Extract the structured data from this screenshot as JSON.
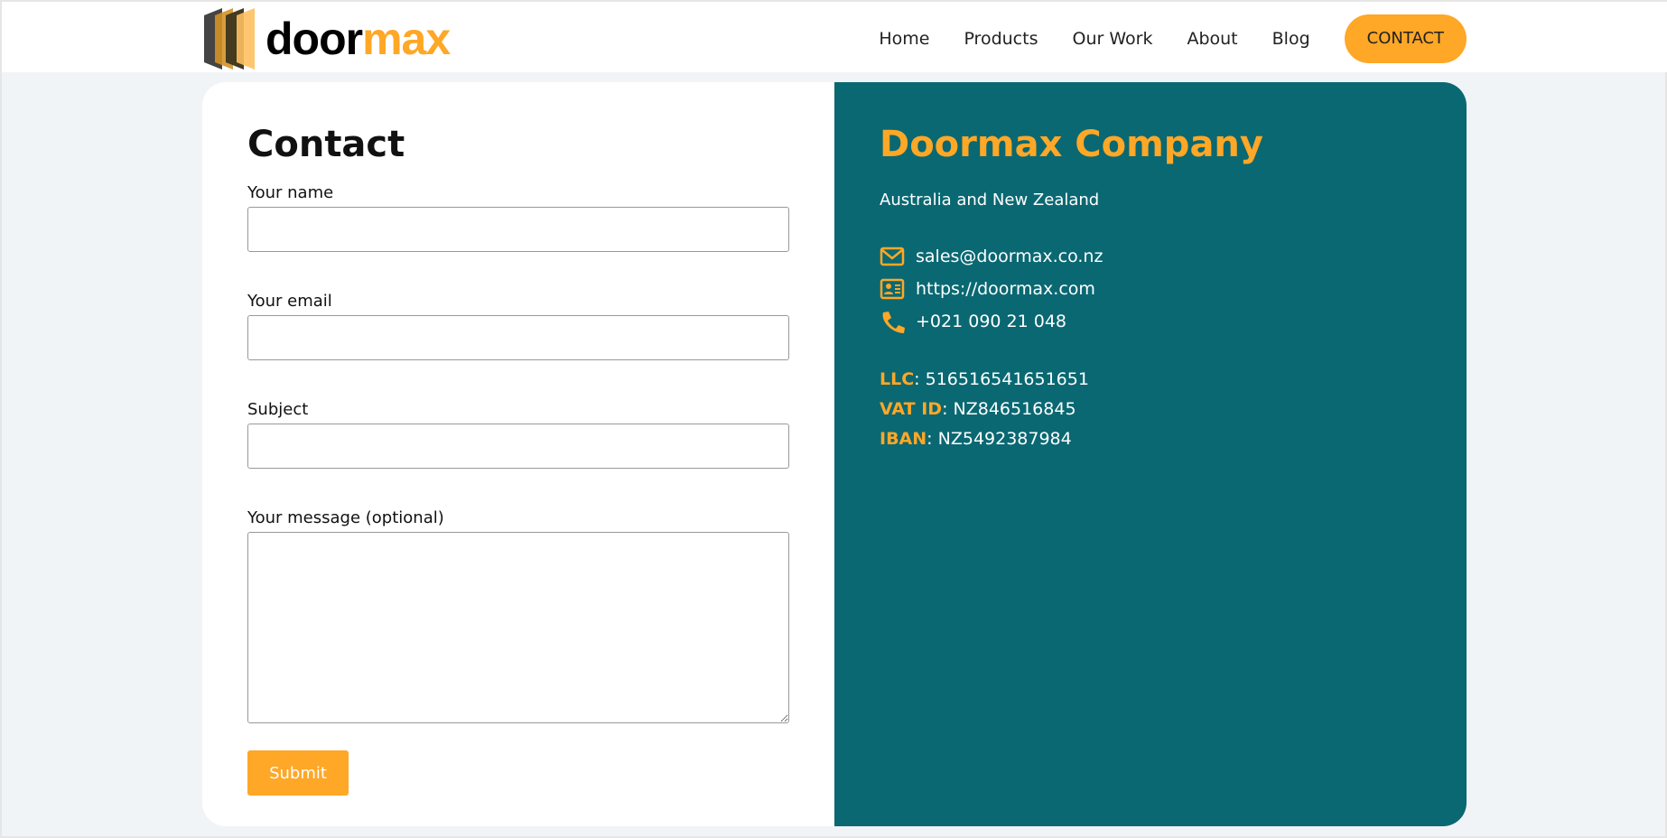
{
  "brand": {
    "logo_part1": "door",
    "logo_part2": "max"
  },
  "nav": {
    "items": [
      "Home",
      "Products",
      "Our Work",
      "About",
      "Blog"
    ],
    "cta": "CONTACT"
  },
  "form": {
    "title": "Contact",
    "name_label": "Your name",
    "email_label": "Your email",
    "subject_label": "Subject",
    "message_label": "Your message (optional)",
    "submit": "Submit"
  },
  "company": {
    "name": "Doormax Company",
    "region": "Australia and New Zealand",
    "email": "sales@doormax.co.nz",
    "website": "https://doormax.com",
    "phone": "+021 090 21 048",
    "llc_label": "LLC",
    "llc": "516516541651651",
    "vat_label": "VAT ID",
    "vat": "NZ846516845",
    "iban_label": "IBAN",
    "iban": "NZ5492387984"
  },
  "colors": {
    "accent": "#ffa726",
    "panel": "#0a6872"
  }
}
